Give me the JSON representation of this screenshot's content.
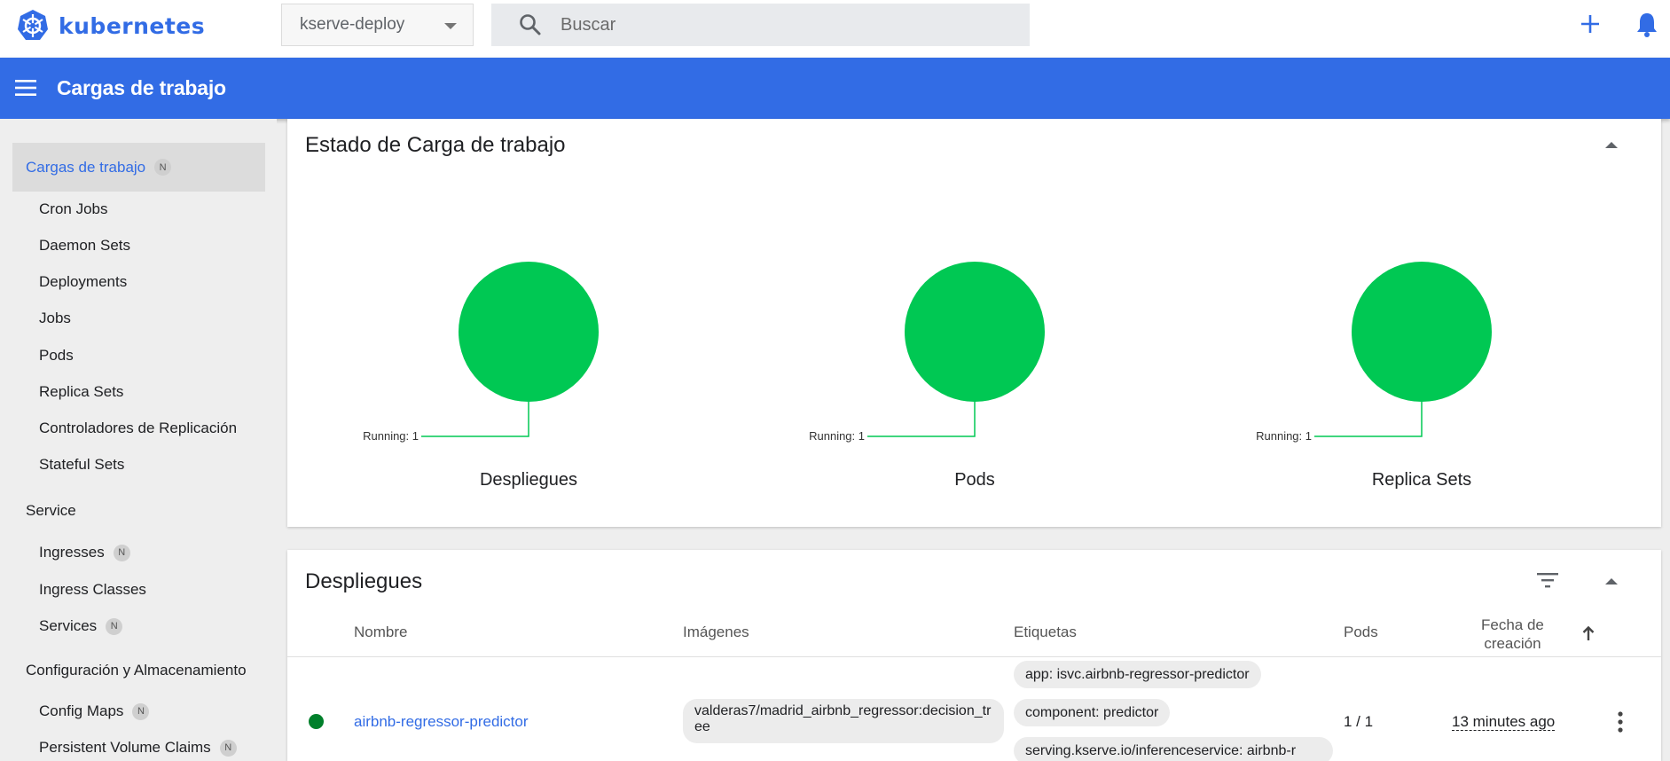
{
  "topbar": {
    "logo_text": "kubernetes",
    "namespace": "kserve-deploy",
    "search_placeholder": "Buscar",
    "brand_color": "#326ce5"
  },
  "appbar": {
    "title": "Cargas de trabajo"
  },
  "sidebar": {
    "active": {
      "label": "Cargas de trabajo",
      "badge": "N"
    },
    "workloads": [
      {
        "label": "Cron Jobs"
      },
      {
        "label": "Daemon Sets"
      },
      {
        "label": "Deployments"
      },
      {
        "label": "Jobs"
      },
      {
        "label": "Pods"
      },
      {
        "label": "Replica Sets"
      },
      {
        "label": "Controladores de Replicación"
      },
      {
        "label": "Stateful Sets"
      }
    ],
    "service_section": "Service",
    "service_items": [
      {
        "label": "Ingresses",
        "badge": "N"
      },
      {
        "label": "Ingress Classes"
      },
      {
        "label": "Services",
        "badge": "N"
      }
    ],
    "config_section": "Configuración y Almacenamiento",
    "config_items": [
      {
        "label": "Config Maps",
        "badge": "N"
      },
      {
        "label": "Persistent Volume Claims",
        "badge": "N"
      }
    ]
  },
  "status_card": {
    "title": "Estado de Carga de trabajo",
    "charts": [
      {
        "caption": "Despliegues",
        "label": "Running: 1",
        "running": 1
      },
      {
        "caption": "Pods",
        "label": "Running: 1",
        "running": 1
      },
      {
        "caption": "Replica Sets",
        "label": "Running: 1",
        "running": 1
      }
    ],
    "running_color": "#00c853"
  },
  "deployments_card": {
    "title": "Despliegues",
    "columns": {
      "name": "Nombre",
      "images": "Imágenes",
      "labels": "Etiquetas",
      "pods": "Pods",
      "created_line1": "Fecha de",
      "created_line2": "creación"
    },
    "row": {
      "name": "airbnb-regressor-predictor",
      "image": "valderas7/madrid_airbnb_regressor:decision_tree",
      "labels": [
        "app: isvc.airbnb-regressor-predictor",
        "component: predictor",
        "serving.kserve.io/inferenceservice: airbnb-r"
      ],
      "pods": "1 / 1",
      "age": "13 minutes ago",
      "status_color": "#00802b"
    }
  }
}
